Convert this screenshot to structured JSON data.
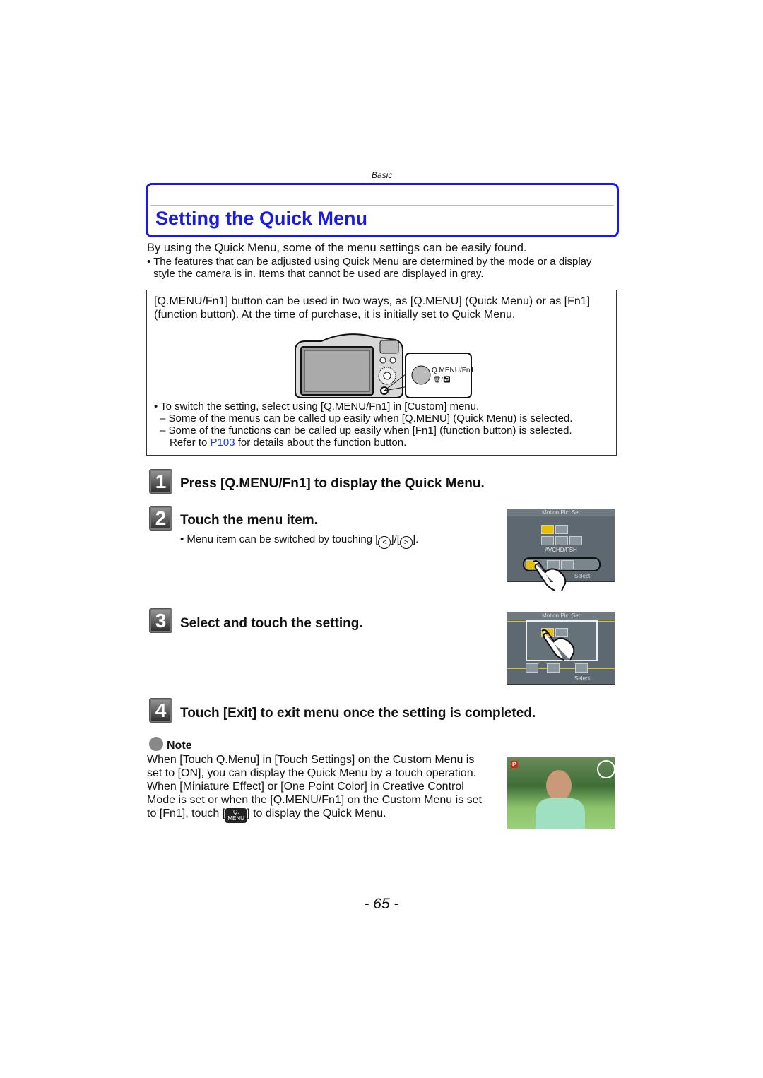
{
  "header": {
    "section": "Basic"
  },
  "title": "Setting the Quick Menu",
  "intro": {
    "lead": "By using the Quick Menu, some of the menu settings can be easily found.",
    "bullet_line1": "• The features that can be adjusted using Quick Menu are determined by the mode or a display",
    "bullet_line2": "style the camera is in. Items that cannot be used are displayed in gray."
  },
  "infobox": {
    "line1": "[Q.MENU/Fn1] button can be used in two ways, as [Q.MENU] (Quick Menu) or as [Fn1]",
    "line2": "(function button). At the time of purchase, it is initially set to Quick Menu.",
    "callout_label": "Q.MENU/Fn1",
    "callout_sub": "🗑/↩",
    "bullet": "• To switch the setting, select using [Q.MENU/Fn1] in [Custom] menu.",
    "dash1": "– Some of the menus can be called up easily when [Q.MENU] (Quick Menu) is selected.",
    "dash2": "– Some of the functions can be called up easily when [Fn1] (function button) is selected.",
    "refer_pre": "Refer to ",
    "refer_link": "P103",
    "refer_post": " for details about the function button."
  },
  "steps": [
    {
      "num": "1",
      "text": "Press [Q.MENU/Fn1] to display the Quick Menu."
    },
    {
      "num": "2",
      "text": "Touch the menu item.",
      "sub_pre": "• Menu item can be switched by touching [",
      "sub_left": "<",
      "sub_mid": "]/[",
      "sub_right": ">",
      "sub_post": "]."
    },
    {
      "num": "3",
      "text": "Select and touch the setting."
    },
    {
      "num": "4",
      "text": "Touch [Exit] to exit menu once the setting is completed."
    }
  ],
  "screens": {
    "title": "Motion Pic. Set",
    "format": "AVCHD/FSH",
    "select": "Select"
  },
  "note": {
    "heading": "Note",
    "lines": [
      "When [Touch Q.Menu] in [Touch Settings] on the Custom Menu is",
      "set to [ON], you can display the Quick Menu by a touch operation.",
      "When [Miniature Effect] or [One Point Color] in Creative Control",
      "Mode is set or when the [Q.MENU/Fn1] on the Custom Menu is set"
    ],
    "last_pre": "to [Fn1], touch [",
    "icon_top": "Q.",
    "icon_bottom": "MENU",
    "last_post": "] to display the Quick Menu.",
    "photo_mode": "P"
  },
  "page_number": "- 65 -",
  "colors": {
    "accent": "#1b1be0",
    "link": "#1a3fe0",
    "highlight": "#e8c000"
  }
}
